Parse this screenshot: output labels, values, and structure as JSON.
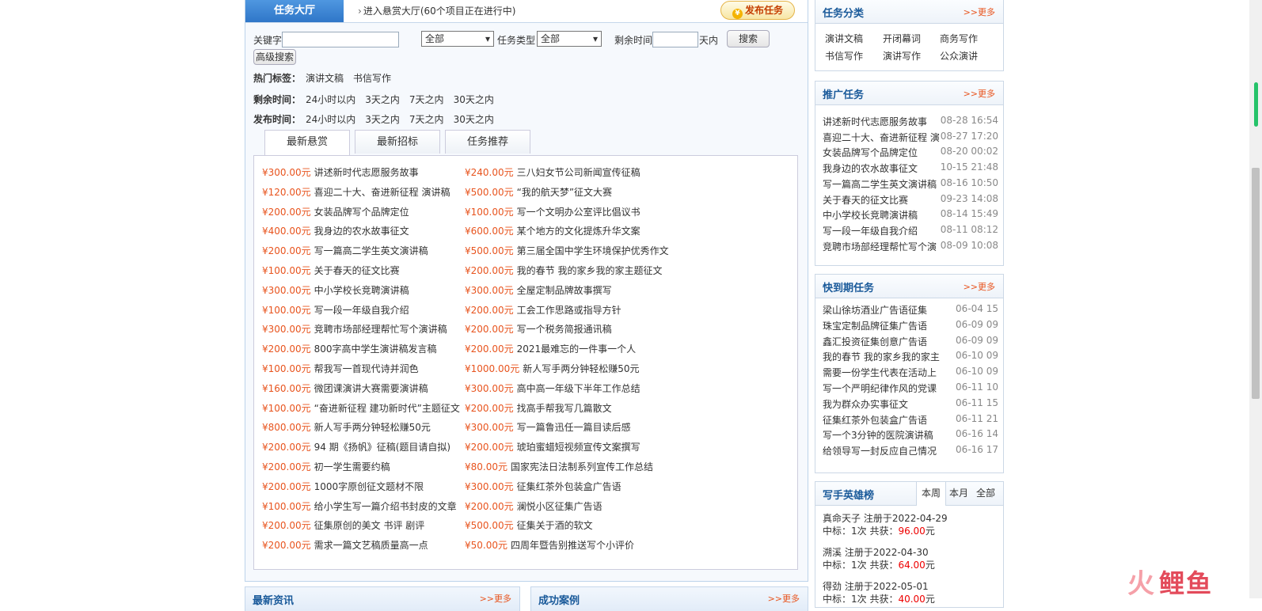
{
  "header": {
    "main_tab": "任务大厅",
    "enter_text": "进入悬赏大厅(60个项目正在进行中)",
    "publish_label": "发布任务",
    "publish_icon": "coin-icon"
  },
  "search": {
    "keyword_label": "关键字",
    "keyword_value": "",
    "category_value": "全部",
    "type_label": "任务类型",
    "type_value": "全部",
    "remaining_label": "剩余时间",
    "remaining_value": "",
    "days_unit": "天内",
    "search_button": "搜索",
    "advanced_button": "高级搜索"
  },
  "filters": [
    {
      "label": "热门标签：",
      "options": [
        "演讲文稿",
        "书信写作"
      ]
    },
    {
      "label": "剩余时间：",
      "options": [
        "24小时以内",
        "3天之内",
        "7天之内",
        "30天之内"
      ]
    },
    {
      "label": "发布时间：",
      "options": [
        "24小时以内",
        "3天之内",
        "7天之内",
        "30天之内"
      ]
    }
  ],
  "tabs": [
    "最新悬赏",
    "最新招标",
    "任务推荐"
  ],
  "tasks_left": [
    {
      "price": "¥300.00元",
      "title": "讲述新时代志愿服务故事"
    },
    {
      "price": "¥120.00元",
      "title": "喜迎二十大、奋进新征程 演讲稿"
    },
    {
      "price": "¥200.00元",
      "title": "女装品牌写个品牌定位"
    },
    {
      "price": "¥400.00元",
      "title": "我身边的农水故事征文"
    },
    {
      "price": "¥200.00元",
      "title": "写一篇高二学生英文演讲稿"
    },
    {
      "price": "¥100.00元",
      "title": "关于春天的征文比赛"
    },
    {
      "price": "¥300.00元",
      "title": "中小学校长竞聘演讲稿"
    },
    {
      "price": "¥100.00元",
      "title": "写一段一年级自我介绍"
    },
    {
      "price": "¥300.00元",
      "title": "竞聘市场部经理帮忙写个演讲稿"
    },
    {
      "price": "¥200.00元",
      "title": "800字高中学生演讲稿发言稿"
    },
    {
      "price": "¥100.00元",
      "title": "帮我写一首现代诗并润色"
    },
    {
      "price": "¥160.00元",
      "title": "微团课演讲大赛需要演讲稿"
    },
    {
      "price": "¥100.00元",
      "title": "“奋进新征程  建功新时代”主题征文"
    },
    {
      "price": "¥800.00元",
      "title": "新人写手两分钟轻松赚50元"
    },
    {
      "price": "¥200.00元",
      "title": "94 期《扬帆》征稿(题目请自拟)"
    },
    {
      "price": "¥200.00元",
      "title": "初一学生需要约稿"
    },
    {
      "price": "¥200.00元",
      "title": "1000字原创征文题材不限"
    },
    {
      "price": "¥100.00元",
      "title": "给小学生写一篇介绍书封皮的文章"
    },
    {
      "price": "¥200.00元",
      "title": "征集原创的美文 书评 剧评"
    },
    {
      "price": "¥200.00元",
      "title": "需求一篇文艺稿质量高一点"
    }
  ],
  "tasks_right": [
    {
      "price": "¥240.00元",
      "title": "三八妇女节公司新闻宣传征稿"
    },
    {
      "price": "¥500.00元",
      "title": "“我的航天梦”征文大赛"
    },
    {
      "price": "¥100.00元",
      "title": "写一个文明办公室评比倡议书"
    },
    {
      "price": "¥600.00元",
      "title": "某个地方的文化提炼升华文案"
    },
    {
      "price": "¥500.00元",
      "title": "第三届全国中学生环境保护优秀作文"
    },
    {
      "price": "¥200.00元",
      "title": "我的春节 我的家乡我的家主题征文"
    },
    {
      "price": "¥300.00元",
      "title": "全屋定制品牌故事撰写"
    },
    {
      "price": "¥200.00元",
      "title": "工会工作思路或指导方针"
    },
    {
      "price": "¥200.00元",
      "title": "写一个税务简报通讯稿"
    },
    {
      "price": "¥200.00元",
      "title": "2021最难忘的一件事一个人"
    },
    {
      "price": "¥1000.00元",
      "title": "新人写手两分钟轻松赚50元"
    },
    {
      "price": "¥300.00元",
      "title": "高中高一年级下半年工作总结"
    },
    {
      "price": "¥200.00元",
      "title": "找高手帮我写几篇散文"
    },
    {
      "price": "¥300.00元",
      "title": "写一篇鲁迅任一篇目读后感"
    },
    {
      "price": "¥200.00元",
      "title": "琥珀蜜蜡短视频宣传文案撰写"
    },
    {
      "price": "¥80.00元",
      "title": "国家宪法日法制系列宣传工作总结"
    },
    {
      "price": "¥300.00元",
      "title": "征集红茶外包装盒广告语"
    },
    {
      "price": "¥200.00元",
      "title": "澜悦小区征集广告语"
    },
    {
      "price": "¥500.00元",
      "title": "征集关于酒的软文"
    },
    {
      "price": "¥50.00元",
      "title": "四周年暨告别推送写个小评价"
    }
  ],
  "bottom": [
    {
      "title": "最新资讯",
      "more": ">>更多"
    },
    {
      "title": "成功案例",
      "more": ">>更多"
    }
  ],
  "categories": {
    "title": "任务分类",
    "more": ">>更多",
    "items": [
      "演讲文稿",
      "开闭幕词",
      "商务写作",
      "书信写作",
      "演讲写作",
      "公众演讲"
    ]
  },
  "promoted": {
    "title": "推广任务",
    "more": ">>更多",
    "items": [
      {
        "title": "讲述新时代志愿服务故事",
        "date": "08-28 16:54"
      },
      {
        "title": "喜迎二十大、奋进新征程 演",
        "date": "08-27 17:20"
      },
      {
        "title": "女装品牌写个品牌定位",
        "date": "08-20 00:02"
      },
      {
        "title": "我身边的农水故事征文",
        "date": "10-15 21:48"
      },
      {
        "title": "写一篇高二学生英文演讲稿",
        "date": "08-16 10:50"
      },
      {
        "title": "关于春天的征文比赛",
        "date": "09-23 14:08"
      },
      {
        "title": "中小学校长竞聘演讲稿",
        "date": "08-14 15:49"
      },
      {
        "title": "写一段一年级自我介绍",
        "date": "08-11 08:12"
      },
      {
        "title": "竞聘市场部经理帮忙写个演",
        "date": "08-09 10:08"
      }
    ]
  },
  "expiring": {
    "title": "快到期任务",
    "more": ">>更多",
    "items": [
      {
        "title": "梁山徐坊酒业广告语征集",
        "date": "06-04 15"
      },
      {
        "title": "珠宝定制品牌征集广告语",
        "date": "06-09 09"
      },
      {
        "title": "鑫汇投资征集创意广告语",
        "date": "06-09 09"
      },
      {
        "title": "我的春节 我的家乡我的家主",
        "date": "06-10 09"
      },
      {
        "title": "需要一份学生代表在活动上",
        "date": "06-10 09"
      },
      {
        "title": "写一个严明纪律作风的党课",
        "date": "06-11 10"
      },
      {
        "title": "我为群众办实事征文",
        "date": "06-11 15"
      },
      {
        "title": "征集红茶外包装盒广告语",
        "date": "06-11 21"
      },
      {
        "title": "写一个3分钟的医院演讲稿",
        "date": "06-16 14"
      },
      {
        "title": "给领导写一封反应自己情况",
        "date": "06-16 17"
      }
    ]
  },
  "heroes": {
    "title": "写手英雄榜",
    "tabs": [
      "本周",
      "本月",
      "全部"
    ],
    "items": [
      {
        "name": "真命天子",
        "reg": "注册于2022-04-29",
        "bid": "中标：1次 共获：",
        "amount": "96.00",
        "unit": "元"
      },
      {
        "name": "溯溪",
        "reg": "注册于2022-04-30",
        "bid": "中标：1次 共获：",
        "amount": "64.00",
        "unit": "元"
      },
      {
        "name": "得劲",
        "reg": "注册于2022-05-01",
        "bid": "中标：1次 共获：",
        "amount": "40.00",
        "unit": "元"
      }
    ]
  },
  "watermark": {
    "fire": "火",
    "text": "鲤鱼"
  }
}
